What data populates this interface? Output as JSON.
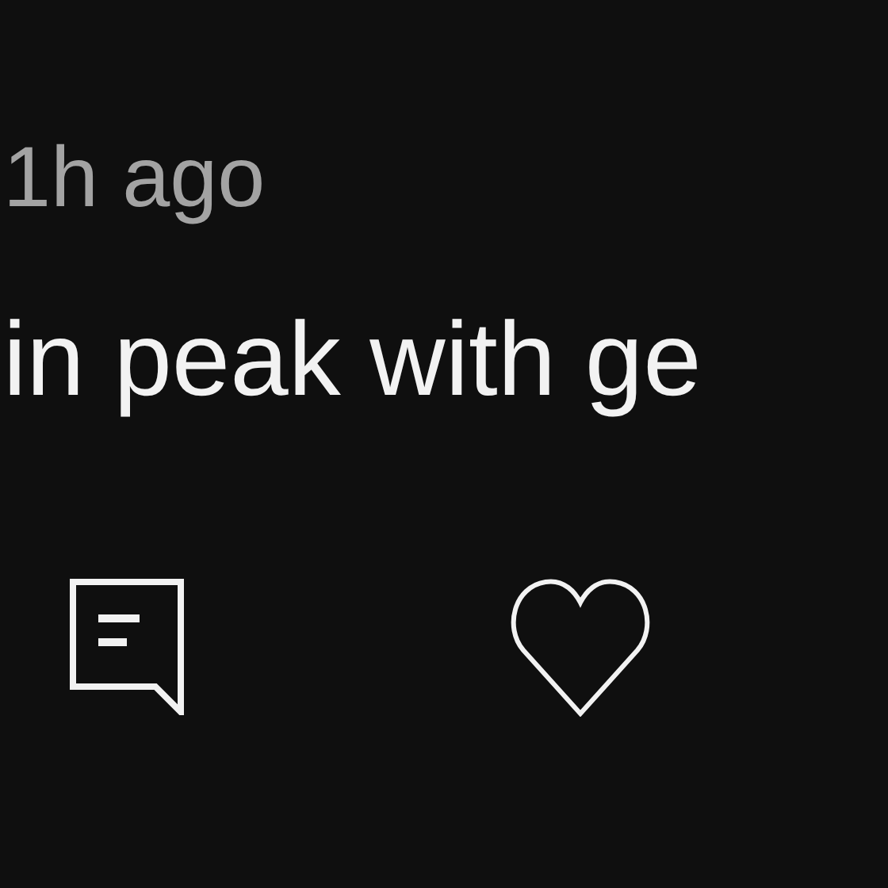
{
  "post": {
    "time": "1h ago",
    "text": "in peak with ge"
  }
}
